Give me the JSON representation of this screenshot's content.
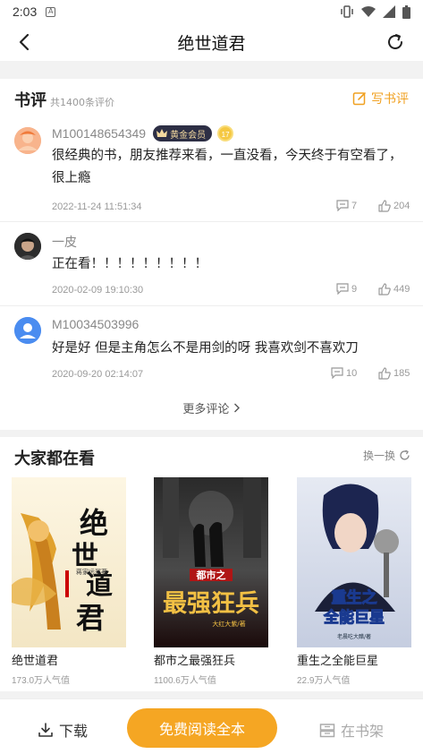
{
  "status_bar": {
    "time": "2:03",
    "sim_label": "A"
  },
  "header": {
    "title": "绝世道君"
  },
  "reviews": {
    "heading": "书评",
    "count_text": "共1400条评价",
    "write_label": "写书评",
    "items": [
      {
        "user": "M100148654349",
        "badge": "黄金会员",
        "level": "17",
        "text": "很经典的书，朋友推荐来看，一直没看，今天终于有空看了，很上瘾",
        "date": "2022-11-24 11:51:34",
        "comments": "7",
        "likes": "204"
      },
      {
        "user": "一皮",
        "text": "正在看！！！！！！！！！",
        "date": "2020-02-09 19:10:30",
        "comments": "9",
        "likes": "449"
      },
      {
        "user": "M10034503996",
        "text": "好是好  但是主角怎么不是用剑的呀  我喜欢剑不喜欢刀",
        "date": "2020-09-20 02:14:07",
        "comments": "10",
        "likes": "185"
      }
    ],
    "more_label": "更多评论"
  },
  "popular": {
    "heading": "大家都在看",
    "swap_label": "换一换",
    "books": [
      {
        "title": "绝世道君",
        "popularity": "173.0万人气值",
        "cover_text": "绝世道君",
        "cover_author": "蒋家远邪著"
      },
      {
        "title": "都市之最强狂兵",
        "popularity": "1100.6万人气值",
        "cover_text_top": "都市之",
        "cover_text_main": "最强狂兵",
        "cover_author": "大红大紫/著"
      },
      {
        "title": "重生之全能巨星",
        "popularity": "22.9万人气值",
        "cover_text_main": "重生之全能巨星",
        "cover_author": "老晨吃大醋/著"
      }
    ]
  },
  "bottom_bar": {
    "download_label": "下载",
    "read_label": "免费阅读全本",
    "shelf_label": "在书架"
  },
  "colors": {
    "accent": "#f5a623",
    "badge_bg": "#2d2f45"
  }
}
